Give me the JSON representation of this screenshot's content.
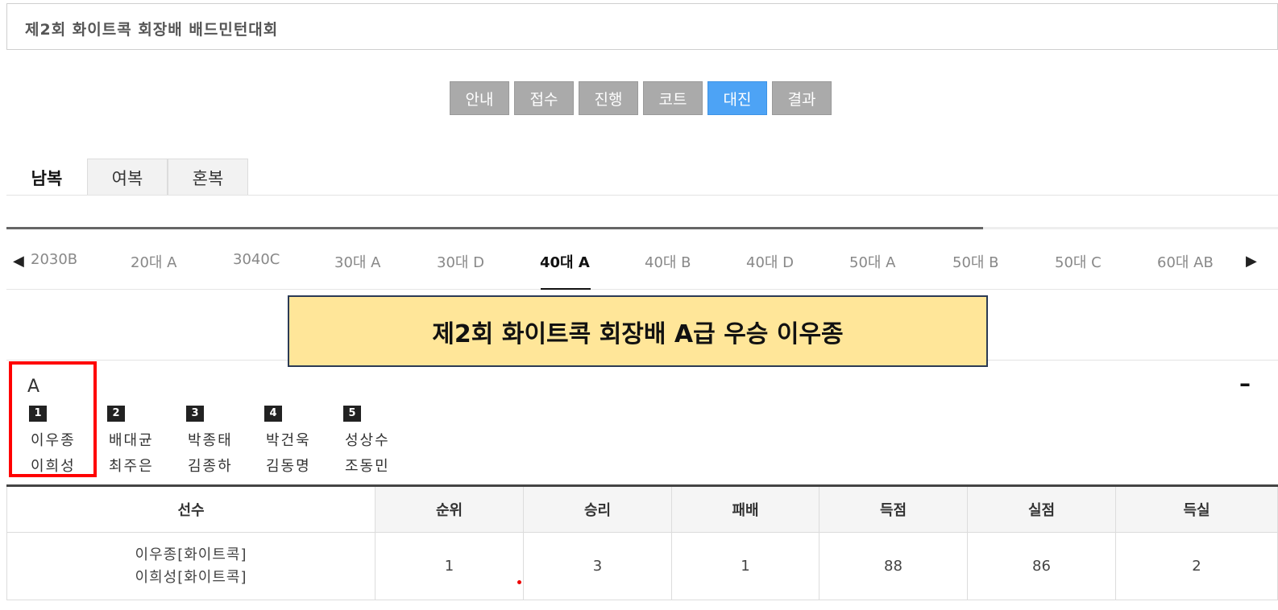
{
  "header": {
    "title": "제2회 화이트콕 회장배 배드민턴대회"
  },
  "menu": [
    {
      "label": "안내",
      "active": false
    },
    {
      "label": "접수",
      "active": false
    },
    {
      "label": "진행",
      "active": false
    },
    {
      "label": "코트",
      "active": false
    },
    {
      "label": "대진",
      "active": true
    },
    {
      "label": "결과",
      "active": false
    }
  ],
  "tabs": [
    {
      "label": "남복",
      "active": true
    },
    {
      "label": "여복",
      "active": false
    },
    {
      "label": "혼복",
      "active": false
    }
  ],
  "categories": [
    "2030B",
    "20대 A",
    "3040C",
    "30대 A",
    "30대 D",
    "40대 A",
    "40대 B",
    "40대 D",
    "50대 A",
    "50대 B",
    "50대 C",
    "60대 AB"
  ],
  "active_category": "40대 A",
  "banner": {
    "text": "제2회 화이트콕 회장배 A급 우승 이우종"
  },
  "group": {
    "name": "A",
    "collapse_symbol": "–",
    "teams": [
      {
        "rank": "1",
        "players": [
          "이우종",
          "이희성"
        ]
      },
      {
        "rank": "2",
        "players": [
          "배대균",
          "최주은"
        ]
      },
      {
        "rank": "3",
        "players": [
          "박종태",
          "김종하"
        ]
      },
      {
        "rank": "4",
        "players": [
          "박건욱",
          "김동명"
        ]
      },
      {
        "rank": "5",
        "players": [
          "성상수",
          "조동민"
        ]
      }
    ]
  },
  "standings": {
    "headers": [
      "선수",
      "순위",
      "승리",
      "패배",
      "득점",
      "실점",
      "득실"
    ],
    "rows": [
      {
        "players": [
          "이우종[화이트콕]",
          "이희성[화이트콕]"
        ],
        "rank": "1",
        "wins": "3",
        "losses": "1",
        "points_for": "88",
        "points_against": "86",
        "diff": "2"
      }
    ]
  },
  "icons": {
    "prev": "triangle-left-icon",
    "next": "triangle-right-icon"
  },
  "colors": {
    "active_menu": "#4da3f5",
    "menu": "#aaaaaa",
    "banner_bg": "#ffe699",
    "highlight": "#ff0000"
  }
}
